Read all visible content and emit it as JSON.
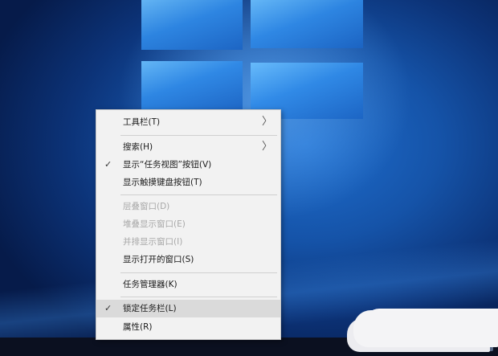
{
  "context_menu": {
    "items": [
      {
        "label": "工具栏(T)"
      },
      {
        "label": "搜索(H)"
      },
      {
        "label": "显示“任务视图”按钮(V)"
      },
      {
        "label": "显示触摸键盘按钮(T)"
      },
      {
        "label": "层叠窗口(D)"
      },
      {
        "label": "堆叠显示窗口(E)"
      },
      {
        "label": "并排显示窗口(I)"
      },
      {
        "label": "显示打开的窗口(S)"
      },
      {
        "label": "任务管理器(K)"
      },
      {
        "label": "锁定任务栏(L)"
      },
      {
        "label": "属性(R)"
      }
    ],
    "check_glyph": "✓",
    "submenu_glyph": "〉"
  },
  "colors": {
    "menu_bg": "#f2f2f2",
    "disabled_text": "#a8a8a8",
    "highlight_bg": "#dadada",
    "taskbar_bg": "#0b1020"
  }
}
